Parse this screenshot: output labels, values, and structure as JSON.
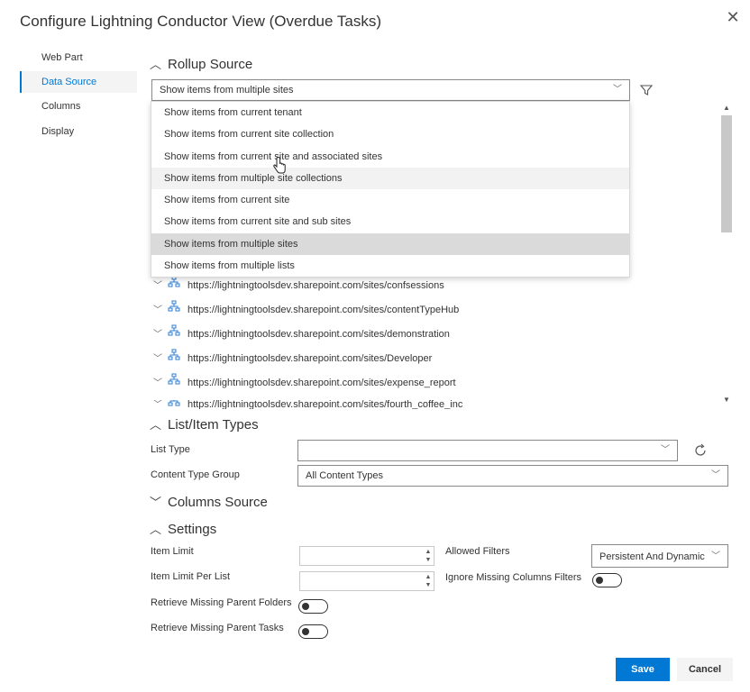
{
  "dialog": {
    "title": "Configure Lightning Conductor View (Overdue Tasks)",
    "close_glyph": "✕"
  },
  "nav": {
    "items": [
      {
        "label": "Web Part"
      },
      {
        "label": "Data Source"
      },
      {
        "label": "Columns"
      },
      {
        "label": "Display"
      }
    ],
    "active": "Data Source"
  },
  "rollup": {
    "heading": "Rollup Source",
    "selected_value": "Show items from multiple sites",
    "options": [
      "Show items from current tenant",
      "Show items from current site collection",
      "Show items from current site and associated sites",
      "Show items from multiple site collections",
      "Show items from current site",
      "Show items from current site and sub sites",
      "Show items from multiple sites",
      "Show items from multiple lists"
    ],
    "hovered_option": "Show items from multiple site collections"
  },
  "sites": [
    "https://lightningtoolsdev.sharepoint.com/sites/confsessions",
    "https://lightningtoolsdev.sharepoint.com/sites/contentTypeHub",
    "https://lightningtoolsdev.sharepoint.com/sites/demonstration",
    "https://lightningtoolsdev.sharepoint.com/sites/Developer",
    "https://lightningtoolsdev.sharepoint.com/sites/expense_report",
    "https://lightningtoolsdev.sharepoint.com/sites/fourth_coffee_inc"
  ],
  "list_item_types": {
    "heading": "List/Item Types",
    "list_type_label": "List Type",
    "list_type_value": "",
    "content_type_group_label": "Content Type Group",
    "content_type_group_value": "All Content Types"
  },
  "columns_source": {
    "heading": "Columns Source"
  },
  "settings": {
    "heading": "Settings",
    "item_limit_label": "Item Limit",
    "item_limit_value": "",
    "item_limit_per_list_label": "Item Limit Per List",
    "item_limit_per_list_value": "",
    "retrieve_parent_folders_label": "Retrieve Missing Parent Folders",
    "retrieve_parent_tasks_label": "Retrieve Missing Parent Tasks",
    "allowed_filters_label": "Allowed Filters",
    "allowed_filters_value": "Persistent And Dynamic",
    "ignore_missing_label": "Ignore Missing Columns Filters",
    "toggles": {
      "retrieve_parent_folders": false,
      "retrieve_parent_tasks": false,
      "ignore_missing": false
    }
  },
  "footer": {
    "save_label": "Save",
    "cancel_label": "Cancel"
  },
  "colors": {
    "accent": "#0078d4",
    "selected_option_bg": "#dadada",
    "hover_option_bg": "#f2f2f2"
  }
}
